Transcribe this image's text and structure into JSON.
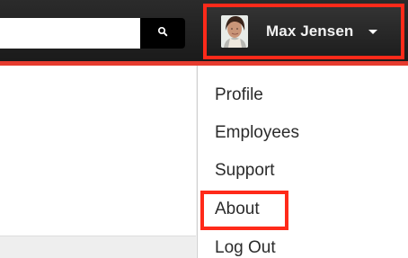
{
  "search": {
    "value": "",
    "placeholder": "",
    "button_icon": "search-icon"
  },
  "user_menu": {
    "name": "Max Jensen",
    "avatar_icon": "avatar",
    "caret_icon": "chevron-down-icon",
    "items": [
      {
        "label": "Profile"
      },
      {
        "label": "Employees"
      },
      {
        "label": "Support"
      },
      {
        "label": "About"
      },
      {
        "label": "Log Out"
      }
    ],
    "highlighted_item": "About"
  },
  "colors": {
    "topbar": "#1f1f1f",
    "highlight": "#ff2a1a",
    "menu_text": "#2b2b2b"
  }
}
